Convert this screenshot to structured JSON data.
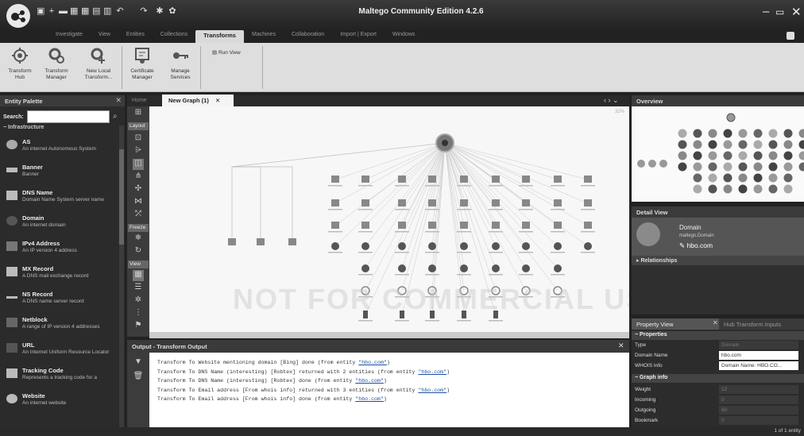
{
  "app": {
    "title": "Maltego Community Edition 4.2.6"
  },
  "ribbon_tabs": [
    "Investigate",
    "View",
    "Entities",
    "Collections",
    "Transforms",
    "Machines",
    "Collaboration",
    "Import | Export",
    "Windows"
  ],
  "active_tab": "Transforms",
  "ribbon": {
    "transform_hub": "Transform\nHub",
    "transform_manager": "Transform\nManager",
    "new_local_transform": "New Local\nTransform...",
    "certificate_manager": "Certificate\nManager",
    "manage_services": "Manage\nServices",
    "run_view": "Run View"
  },
  "palette": {
    "title": "Entity Palette",
    "search_label": "Search:",
    "search_value": "",
    "category": "Infrastructure",
    "items": [
      {
        "title": "AS",
        "desc": "An internet Autonomous System"
      },
      {
        "title": "Banner",
        "desc": "Banner"
      },
      {
        "title": "DNS Name",
        "desc": "Domain Name System server name"
      },
      {
        "title": "Domain",
        "desc": "An internet domain"
      },
      {
        "title": "IPv4 Address",
        "desc": "An IP version 4 address"
      },
      {
        "title": "MX Record",
        "desc": "A DNS mail exchange record"
      },
      {
        "title": "NS Record",
        "desc": "A DNS name server record"
      },
      {
        "title": "Netblock",
        "desc": "A range of IP version 4 addresses"
      },
      {
        "title": "URL",
        "desc": "An Internet Uniform Resource Locator"
      },
      {
        "title": "Tracking Code",
        "desc": "Represents a tracking code for a"
      },
      {
        "title": "Website",
        "desc": "An internet website"
      }
    ]
  },
  "graph": {
    "tabs": [
      "Home",
      "New Graph (1)"
    ],
    "layout_label": "Layout",
    "freeze_label": "Freeze",
    "view_label": "View",
    "zoom": "32%",
    "watermark": "NOT FOR COMMERCIAL USE"
  },
  "output": {
    "title": "Output - Transform Output",
    "lines": [
      {
        "text": "Transform To Website mentioning domain [Bing] done (from entity ",
        "entity": "\"hbo.com\"",
        "tail": ")"
      },
      {
        "text": "Transform To DNS Name (interesting) [Robtex] returned with 2 entities (from entity ",
        "entity": "\"hbo.com\"",
        "tail": ")"
      },
      {
        "text": "Transform To DNS Name (interesting) [Robtex] done (from entity ",
        "entity": "\"hbo.com\"",
        "tail": ")"
      },
      {
        "text": "Transform To Email address [From whois info] returned with 3 entities (from entity ",
        "entity": "\"hbo.com\"",
        "tail": ")"
      },
      {
        "text": "Transform To Email address [From whois info] done (from entity ",
        "entity": "\"hbo.com\"",
        "tail": ")"
      }
    ]
  },
  "overview": {
    "title": "Overview"
  },
  "detail": {
    "title": "Detail View",
    "entity_type": "Domain",
    "entity_sub": "maltego.Domain",
    "entity_value": "hbo.com",
    "relationships": "Relationships"
  },
  "property": {
    "tab1": "Property View",
    "tab2": "Hub Transform Inputs",
    "sections": {
      "properties": "Properties",
      "graph_info": "Graph info"
    },
    "rows": [
      {
        "key": "Type",
        "value": "Domain",
        "dim": true
      },
      {
        "key": "Domain Name",
        "value": "hbo.com",
        "dim": false
      },
      {
        "key": "WHOIS Info",
        "value": "Domain Name: HBO.CO...",
        "dim": false
      }
    ],
    "graph_rows": [
      {
        "key": "Weight",
        "value": "12"
      },
      {
        "key": "Incoming",
        "value": "0"
      },
      {
        "key": "Outgoing",
        "value": "60"
      },
      {
        "key": "Bookmark",
        "value": "0"
      }
    ]
  },
  "status": "1 of 1 entity",
  "colors": {
    "accent": "#4a90d9",
    "ribbon_bg": "#dedede",
    "dark_bg": "#2b2b2b"
  }
}
